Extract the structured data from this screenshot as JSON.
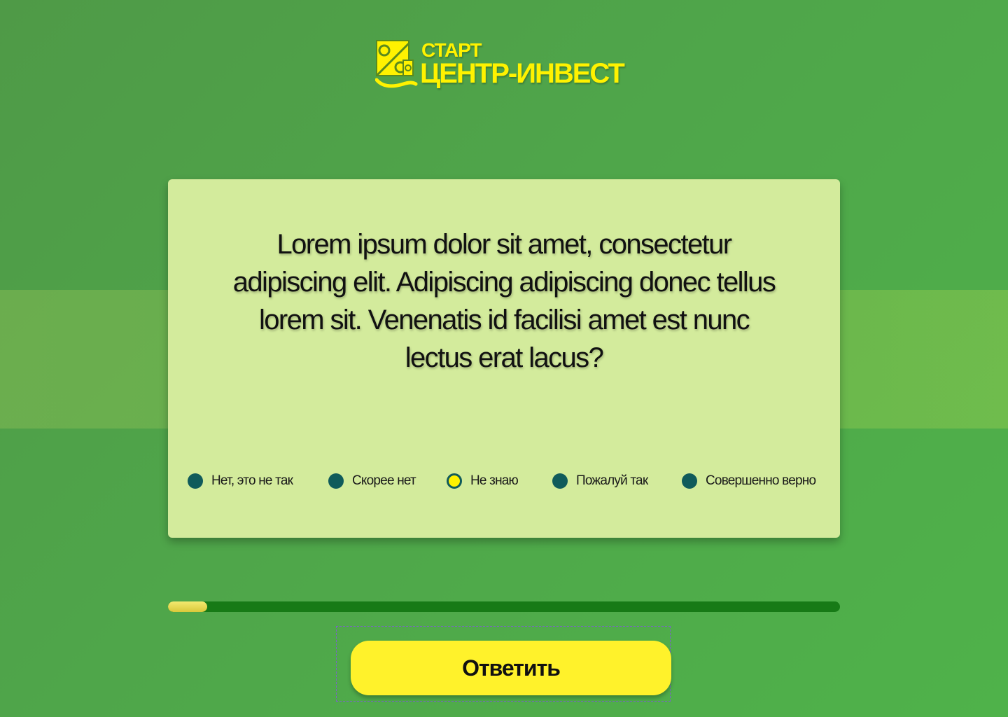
{
  "logo": {
    "line1": "СТАРТ",
    "line2": "ЦЕНТР-ИНВЕСТ",
    "icon": "percent-coin-icon",
    "color": "#fff200"
  },
  "question": {
    "text": "Lorem ipsum dolor sit amet, consectetur adipiscing elit. Adipiscing adipiscing donec tellus lorem sit. Venenatis id facilisi amet est nunc lectus erat lacus?"
  },
  "options": [
    {
      "label": "Нет, это не так",
      "selected": false
    },
    {
      "label": "Скорее нет",
      "selected": false
    },
    {
      "label": "Не знаю",
      "selected": true
    },
    {
      "label": "Пожалуй так",
      "selected": false
    },
    {
      "label": "Совершенно верно",
      "selected": false
    }
  ],
  "progress": {
    "fraction": 0.058
  },
  "submit": {
    "label": "Ответить"
  },
  "colors": {
    "card": "#d3eb9c",
    "radio": "#105b5b",
    "radio_selected": "#fff200",
    "progress_track": "#177a16",
    "button": "#fff22b"
  }
}
